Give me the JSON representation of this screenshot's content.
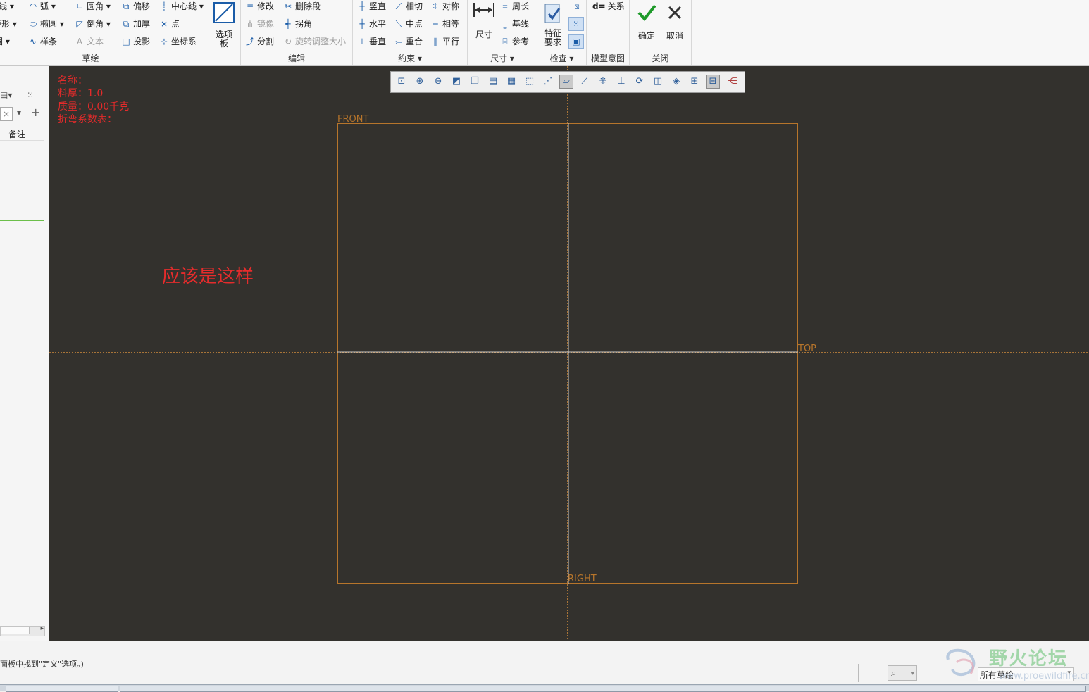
{
  "ribbon": {
    "sketch": {
      "title": "草绘",
      "col1": [
        "线",
        "矩形",
        "圆"
      ],
      "col2": [
        "弧",
        "椭圆",
        "样条"
      ],
      "col3": [
        "圆角",
        "倒角",
        "文本"
      ],
      "col4": [
        "偏移",
        "加厚",
        "投影"
      ],
      "col5": [
        "中心线",
        "点",
        "坐标系"
      ],
      "options_panel": "选项板"
    },
    "edit": {
      "title": "编辑",
      "col1": [
        "修改",
        "镜像",
        "分割"
      ],
      "col2": [
        "删除段",
        "拐角",
        "旋转调整大小"
      ]
    },
    "constrain": {
      "title": "约束",
      "col1": [
        "竖直",
        "水平",
        "垂直"
      ],
      "col2": [
        "相切",
        "中点",
        "重合"
      ],
      "col3": [
        "对称",
        "相等",
        "平行"
      ]
    },
    "dimension": {
      "title": "尺寸",
      "big": "尺寸",
      "items": [
        "周长",
        "基线",
        "参考"
      ]
    },
    "inspect": {
      "title": "检查",
      "big_line1": "特征",
      "big_line2": "要求"
    },
    "model_intent": {
      "title": "模型意图",
      "relation": "关系"
    },
    "close": {
      "title": "关闭",
      "ok": "确定",
      "cancel": "取消"
    }
  },
  "left_panel": {
    "column_header": "备注"
  },
  "canvas": {
    "info_lines": [
      "名称：",
      "料厚：1.0",
      "质量：0.00千克",
      "折弯系数表："
    ],
    "annotation": "应该是这样",
    "planes": {
      "front": "FRONT",
      "top": "TOP",
      "right": "RIGHT"
    },
    "colors": {
      "background": "#33312d",
      "plane": "#b7752b",
      "info": "#e42b2b"
    }
  },
  "view_toolbar": {
    "icons": [
      "refit-icon",
      "zoom-in-icon",
      "zoom-out-icon",
      "repaint-icon",
      "display-style-icon",
      "saved-orientations-icon",
      "view-manager-icon",
      "perspective-icon",
      "plane-display-icon",
      "sketch-view-icon",
      "disp-dims-icon",
      "disp-constraints-icon",
      "disp-grid-icon",
      "disp-vertices-icon",
      "shade-closed-icon",
      "highlight-open-ends-icon",
      "overlap-geometry-icon",
      "spin-center-icon",
      "settings-icon",
      "network-icon"
    ]
  },
  "status": {
    "message": "面板中找到\"定义\"选项。)",
    "filter_value": "所有草绘",
    "watermark_cn": "野火论坛",
    "watermark_url": "www.proewildfire.cn"
  }
}
